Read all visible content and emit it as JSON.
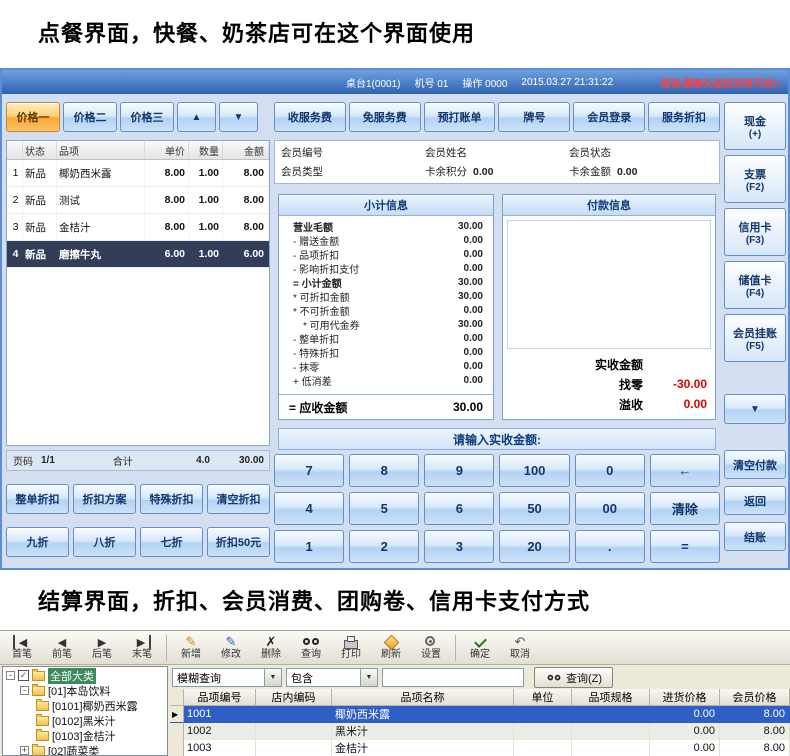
{
  "captions": {
    "top": "点餐界面，快餐、奶茶店可在这个界面使用",
    "bottom": "结算界面，折扣、会员消费、团购卷、信用卡支付方式"
  },
  "colors": {
    "accent_blue": "#2f62b0",
    "selected_order_row": "#323e58",
    "alert_red": "#ff4040",
    "amount_red": "#e00000",
    "active_tab_orange": "#f7a93a",
    "grid_selected_blue": "#2f5fc4"
  },
  "pos": {
    "titlebar": {
      "table": "桌台1(0001)",
      "machine": "机号 01",
      "operator": "操作 0000",
      "datetime": "2015.03.27 21:31:22",
      "alert": "错误,摄像头监控没有开启!!"
    },
    "price_tabs": [
      {
        "label": "价格一",
        "cls": "active"
      },
      {
        "label": "价格二",
        "cls": ""
      },
      {
        "label": "价格三",
        "cls": ""
      }
    ],
    "scroll_up": "▲",
    "scroll_down": "▼",
    "order": {
      "headers": [
        "状态",
        "品项",
        "单价",
        "数量",
        "金额"
      ],
      "rows": [
        {
          "no": "1",
          "status": "新品",
          "name": "椰奶西米露",
          "price": "8.00",
          "qty": "1.00",
          "amount": "8.00",
          "cls": ""
        },
        {
          "no": "2",
          "status": "新品",
          "name": "测试",
          "price": "8.00",
          "qty": "1.00",
          "amount": "8.00",
          "cls": ""
        },
        {
          "no": "3",
          "status": "新品",
          "name": "金桔汁",
          "price": "8.00",
          "qty": "1.00",
          "amount": "8.00",
          "cls": ""
        },
        {
          "no": "4",
          "status": "新品",
          "name": "磨擦牛丸",
          "price": "6.00",
          "qty": "1.00",
          "amount": "6.00",
          "cls": "sel"
        }
      ],
      "footer": {
        "page_label": "页码",
        "page": "1/1",
        "total_label": "合计",
        "total_qty": "4.0",
        "total_amount": "30.00"
      }
    },
    "discounts": [
      "整单折扣",
      "折扣方案",
      "特殊折扣",
      "清空折扣",
      "九折",
      "八折",
      "七折",
      "折扣50元"
    ],
    "services": [
      "收服务费",
      "免服务费",
      "预打账单",
      "牌号",
      "会员登录",
      "服务折扣"
    ],
    "member": {
      "row1": [
        {
          "label": "会员编号",
          "value": ""
        },
        {
          "label": "会员姓名",
          "value": ""
        },
        {
          "label": "会员状态",
          "value": ""
        }
      ],
      "row2": [
        {
          "label": "会员类型",
          "value": ""
        },
        {
          "label": "卡余积分",
          "value": "0.00"
        },
        {
          "label": "卡余金额",
          "value": "0.00"
        }
      ]
    },
    "subtotal": {
      "title": "小计信息",
      "lines": [
        {
          "label": "营业毛额",
          "value": "30.00",
          "cls": "bold"
        },
        {
          "label": "- 赠送金额",
          "value": "0.00",
          "cls": ""
        },
        {
          "label": "- 品项折扣",
          "value": "0.00",
          "cls": ""
        },
        {
          "label": "- 影响折扣支付",
          "value": "0.00",
          "cls": ""
        },
        {
          "label": "= 小计金额",
          "value": "30.00",
          "cls": "bold"
        },
        {
          "label": "* 可折扣金额",
          "value": "30.00",
          "cls": ""
        },
        {
          "label": "* 不可折金额",
          "value": "0.00",
          "cls": ""
        },
        {
          "label": "* 可用代金券",
          "value": "30.00",
          "cls": "indent"
        },
        {
          "label": "- 整单折扣",
          "value": "0.00",
          "cls": ""
        },
        {
          "label": "- 特殊折扣",
          "value": "0.00",
          "cls": ""
        },
        {
          "label": "- 抹零",
          "value": "0.00",
          "cls": ""
        },
        {
          "label": "+ 低消差",
          "value": "0.00",
          "cls": ""
        }
      ],
      "result_label": "= 应收金额",
      "result_value": "30.00"
    },
    "payment": {
      "title": "付款信息",
      "rows": [
        {
          "label": "实收金额",
          "value": "",
          "cls": ""
        },
        {
          "label": "找零",
          "value": "-30.00",
          "cls": "red"
        },
        {
          "label": "溢收",
          "value": "0.00",
          "cls": "red"
        }
      ]
    },
    "prompt": "请输入实收金额:",
    "numpad": [
      "7",
      "8",
      "9",
      "100",
      "0",
      "←",
      "4",
      "5",
      "6",
      "50",
      "00",
      "清除",
      "1",
      "2",
      "3",
      "20",
      ".",
      "="
    ],
    "tenders": [
      {
        "label": "现金",
        "sub": "(+)"
      },
      {
        "label": "支票",
        "sub": "(F2)"
      },
      {
        "label": "信用卡",
        "sub": "(F3)"
      },
      {
        "label": "储值卡",
        "sub": "(F4)"
      },
      {
        "label": "会员挂账",
        "sub": "(F5)"
      }
    ],
    "actions": [
      "清空付款",
      "返回",
      "结账"
    ]
  },
  "manager": {
    "toolbar": [
      "首笔",
      "前笔",
      "后笔",
      "末笔",
      "新增",
      "修改",
      "删除",
      "查询",
      "打印",
      "刷新",
      "设置",
      "确定",
      "取消"
    ],
    "tree": [
      {
        "label": "全部大类"
      },
      {
        "label": "[01]本岛饮料"
      },
      {
        "label": "[0101]椰奶西米露"
      },
      {
        "label": "[0102]黑米汁"
      },
      {
        "label": "[0103]金桔汁"
      },
      {
        "label": "[02]蔬菜类"
      }
    ],
    "filter": {
      "mode": "模糊查询",
      "op": "包含",
      "keyword": "",
      "search_button": "查询(Z)"
    },
    "table": {
      "headers": [
        "品项编号",
        "店内编码",
        "品项名称",
        "单位",
        "品项规格",
        "进货价格",
        "会员价格"
      ],
      "rows": [
        {
          "no": "1001",
          "code": "",
          "name": "椰奶西米露",
          "unit": "",
          "spec": "",
          "cost": "0.00",
          "price": "8.00",
          "cls": "sel"
        },
        {
          "no": "1002",
          "code": "",
          "name": "黑米汁",
          "unit": "",
          "spec": "",
          "cost": "0.00",
          "price": "8.00",
          "cls": "even"
        },
        {
          "no": "1003",
          "code": "",
          "name": "金桔汁",
          "unit": "",
          "spec": "",
          "cost": "0.00",
          "price": "8.00",
          "cls": ""
        }
      ]
    }
  }
}
